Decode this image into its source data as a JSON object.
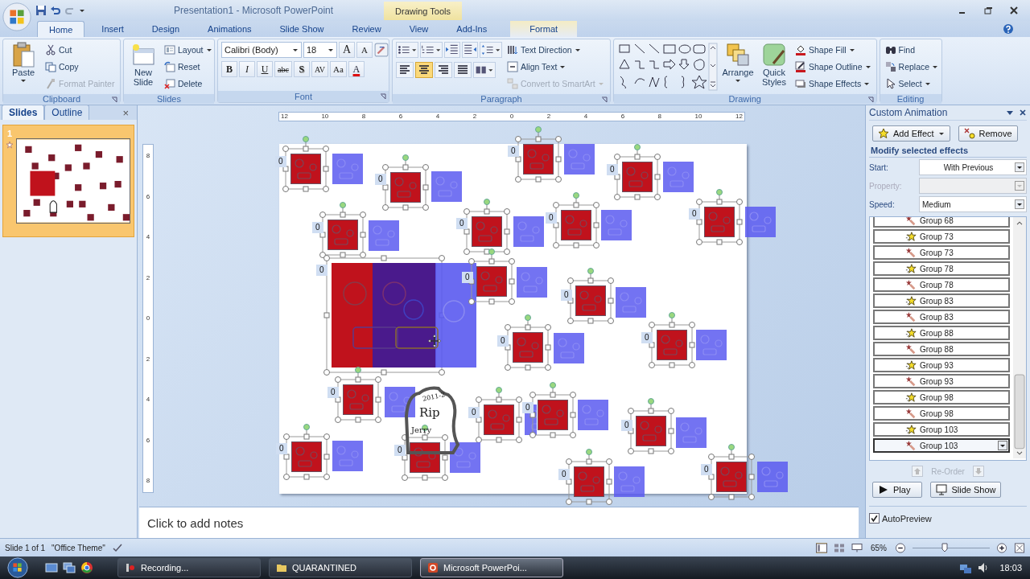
{
  "title_bar": {
    "title": "Presentation1 - Microsoft PowerPoint",
    "contextual": "Drawing Tools"
  },
  "tabs": [
    {
      "label": "Home",
      "selected": true
    },
    {
      "label": "Insert",
      "selected": false
    },
    {
      "label": "Design",
      "selected": false
    },
    {
      "label": "Animations",
      "selected": false
    },
    {
      "label": "Slide Show",
      "selected": false
    },
    {
      "label": "Review",
      "selected": false
    },
    {
      "label": "View",
      "selected": false
    },
    {
      "label": "Add-Ins",
      "selected": false
    },
    {
      "label": "Format",
      "selected": false
    }
  ],
  "clipboard": {
    "label": "Clipboard",
    "paste": "Paste",
    "items": [
      {
        "label": "Cut",
        "disabled": false
      },
      {
        "label": "Copy",
        "disabled": false
      },
      {
        "label": "Format Painter",
        "disabled": true
      }
    ]
  },
  "slides_group": {
    "label": "Slides",
    "new_slide": "New Slide",
    "items": [
      {
        "label": "Layout",
        "dropdown": true
      },
      {
        "label": "Reset",
        "dropdown": false
      },
      {
        "label": "Delete",
        "dropdown": false
      }
    ]
  },
  "font": {
    "label": "Font",
    "face": "Calibri (Body)",
    "size": "18",
    "grow": "A",
    "shrink": "A",
    "buttons": [
      {
        "label": "B",
        "kind": "bold"
      },
      {
        "label": "I",
        "kind": "italic"
      },
      {
        "label": "U",
        "kind": "underline"
      },
      {
        "label": "abc",
        "kind": "strike"
      },
      {
        "label": "S",
        "kind": "shadow"
      },
      {
        "label": "AV",
        "kind": "spacing"
      },
      {
        "label": "Aa",
        "kind": "case"
      },
      {
        "label": "A",
        "kind": "color"
      }
    ]
  },
  "paragraph": {
    "label": "Paragraph",
    "align": [
      {
        "kind": "left",
        "selected": false
      },
      {
        "kind": "center",
        "selected": true
      },
      {
        "kind": "right",
        "selected": false
      },
      {
        "kind": "justify",
        "selected": false
      }
    ],
    "items": [
      {
        "label": "Text Direction",
        "disabled": false
      },
      {
        "label": "Align Text",
        "disabled": false
      },
      {
        "label": "Convert to SmartArt",
        "disabled": true
      }
    ]
  },
  "drawing": {
    "label": "Drawing",
    "arrange": "Arrange",
    "quick_styles": "Quick Styles",
    "items": [
      {
        "label": "Shape Fill",
        "kind": "fill"
      },
      {
        "label": "Shape Outline",
        "kind": "outline"
      },
      {
        "label": "Shape Effects",
        "kind": "effects"
      }
    ]
  },
  "editing": {
    "label": "Editing",
    "items": [
      {
        "label": "Find",
        "kind": "find"
      },
      {
        "label": "Replace",
        "kind": "replace"
      },
      {
        "label": "Select",
        "kind": "select"
      }
    ]
  },
  "slides_pane": {
    "tabs": [
      {
        "label": "Slides",
        "selected": true
      },
      {
        "label": "Outline",
        "selected": false
      }
    ],
    "close": "×",
    "thumbnail_number": "1"
  },
  "ruler": {
    "horizontal": [
      "12",
      "10",
      "8",
      "6",
      "4",
      "2",
      "0",
      "2",
      "4",
      "6",
      "8",
      "10",
      "12"
    ],
    "vertical": [
      "8",
      "6",
      "4",
      "2",
      "0",
      "2",
      "4",
      "6",
      "8"
    ]
  },
  "slide": {
    "shapes": [
      {
        "tag": "0",
        "kind": "small"
      },
      {
        "tag": "0",
        "kind": "small"
      },
      {
        "tag": "0",
        "kind": "small"
      },
      {
        "tag": "0",
        "kind": "small"
      },
      {
        "tag": "0",
        "kind": "small"
      },
      {
        "tag": "0",
        "kind": "small"
      },
      {
        "tag": "0",
        "kind": "small"
      },
      {
        "tag": "0",
        "kind": "small"
      },
      {
        "tag": "0",
        "kind": "large"
      },
      {
        "tag": "0",
        "kind": "small"
      },
      {
        "tag": "0",
        "kind": "small"
      },
      {
        "tag": "0",
        "kind": "small"
      },
      {
        "tag": "0",
        "kind": "small"
      },
      {
        "tag": "0",
        "kind": "small"
      },
      {
        "tag": "0",
        "kind": "small"
      },
      {
        "tag": "0",
        "kind": "small"
      },
      {
        "tag": "0",
        "kind": "small"
      },
      {
        "tag": "0",
        "kind": "small"
      },
      {
        "tag": "0",
        "kind": "small"
      },
      {
        "tag": "0",
        "kind": "small"
      },
      {
        "tag": "0",
        "kind": "small"
      }
    ],
    "handwriting": [
      "2011-2",
      "Rip",
      "Jerry"
    ]
  },
  "notes": {
    "placeholder": "Click to add notes"
  },
  "task_pane": {
    "title": "Custom Animation",
    "add_effect": "Add Effect",
    "remove": "Remove",
    "heading": "Modify selected effects",
    "fields": [
      {
        "label": "Start:",
        "value": "With Previous",
        "disabled": false
      },
      {
        "label": "Property:",
        "disabled": true
      },
      {
        "label": "Speed:",
        "value": "Medium",
        "disabled": false
      }
    ],
    "effects": [
      {
        "label": "Group 68",
        "kind": "exit",
        "selected": false
      },
      {
        "label": "Group 73",
        "kind": "entrance",
        "selected": false
      },
      {
        "label": "Group 73",
        "kind": "exit",
        "selected": false
      },
      {
        "label": "Group 78",
        "kind": "entrance",
        "selected": false
      },
      {
        "label": "Group 78",
        "kind": "exit",
        "selected": false
      },
      {
        "label": "Group 83",
        "kind": "entrance",
        "selected": false
      },
      {
        "label": "Group 83",
        "kind": "exit",
        "selected": false
      },
      {
        "label": "Group 88",
        "kind": "entrance",
        "selected": false
      },
      {
        "label": "Group 88",
        "kind": "exit",
        "selected": false
      },
      {
        "label": "Group 93",
        "kind": "entrance",
        "selected": false
      },
      {
        "label": "Group 93",
        "kind": "exit",
        "selected": false
      },
      {
        "label": "Group 98",
        "kind": "entrance",
        "selected": false
      },
      {
        "label": "Group 98",
        "kind": "exit",
        "selected": false
      },
      {
        "label": "Group 103",
        "kind": "entrance",
        "selected": false
      },
      {
        "label": "Group 103",
        "kind": "exit",
        "selected": true
      }
    ],
    "reorder": "Re-Order",
    "play": "Play",
    "slide_show": "Slide Show",
    "autopreview": {
      "label": "AutoPreview",
      "checked": true
    }
  },
  "status_bar": {
    "slide": "Slide 1 of 1",
    "theme": "\"Office Theme\"",
    "zoom": "65%",
    "zoom_slider": {
      "level": 0.4
    }
  },
  "taskbar": {
    "tasks": [
      {
        "label": "Recording...",
        "kind": "recorder",
        "selected": false
      },
      {
        "label": "QUARANTINED",
        "kind": "folder",
        "selected": false
      },
      {
        "label": "Microsoft PowerPoi...",
        "kind": "powerpoint",
        "selected": true
      }
    ],
    "time": "18:03"
  }
}
